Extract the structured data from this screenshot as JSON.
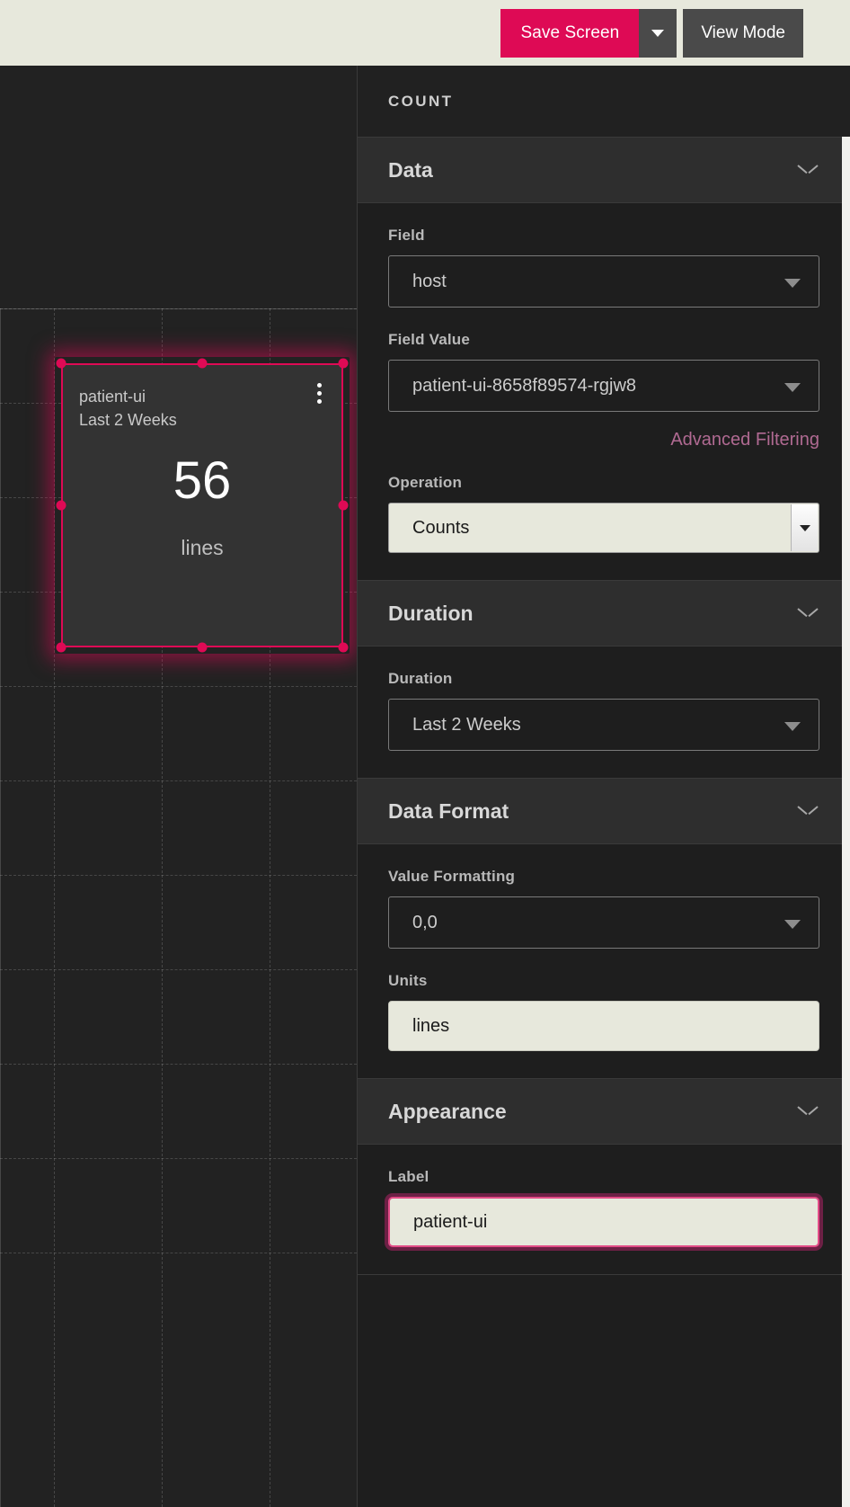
{
  "toolbar": {
    "save_label": "Save Screen",
    "save_caret_icon": "chevron-down-icon",
    "view_mode_label": "View Mode",
    "accent_color": "#de0a55",
    "bar_background": "#e7e8dc"
  },
  "canvas": {
    "widget": {
      "title": "patient-ui",
      "subtitle": "Last 2 Weeks",
      "value": "56",
      "units": "lines",
      "menu_icon": "kebab-menu-icon",
      "selected": true,
      "selection_color": "#de0a55"
    }
  },
  "panel": {
    "header_title": "COUNT",
    "sections": [
      {
        "id": "data",
        "title": "Data",
        "collapse_icon": "chevron-down-icon",
        "fields": {
          "field_label": "Field",
          "field_value": "host",
          "field_value_label": "Field Value",
          "field_value_value": "patient-ui-8658f89574-rgjw8",
          "advanced_filtering_link": "Advanced Filtering",
          "operation_label": "Operation",
          "operation_value": "Counts"
        }
      },
      {
        "id": "duration",
        "title": "Duration",
        "collapse_icon": "chevron-down-icon",
        "fields": {
          "duration_label": "Duration",
          "duration_value": "Last 2 Weeks"
        }
      },
      {
        "id": "data-format",
        "title": "Data Format",
        "collapse_icon": "chevron-down-icon",
        "fields": {
          "value_formatting_label": "Value Formatting",
          "value_formatting_value": "0,0",
          "units_label": "Units",
          "units_value": "lines"
        }
      },
      {
        "id": "appearance",
        "title": "Appearance",
        "collapse_icon": "chevron-down-icon",
        "fields": {
          "label_label": "Label",
          "label_value": "patient-ui"
        }
      }
    ]
  }
}
